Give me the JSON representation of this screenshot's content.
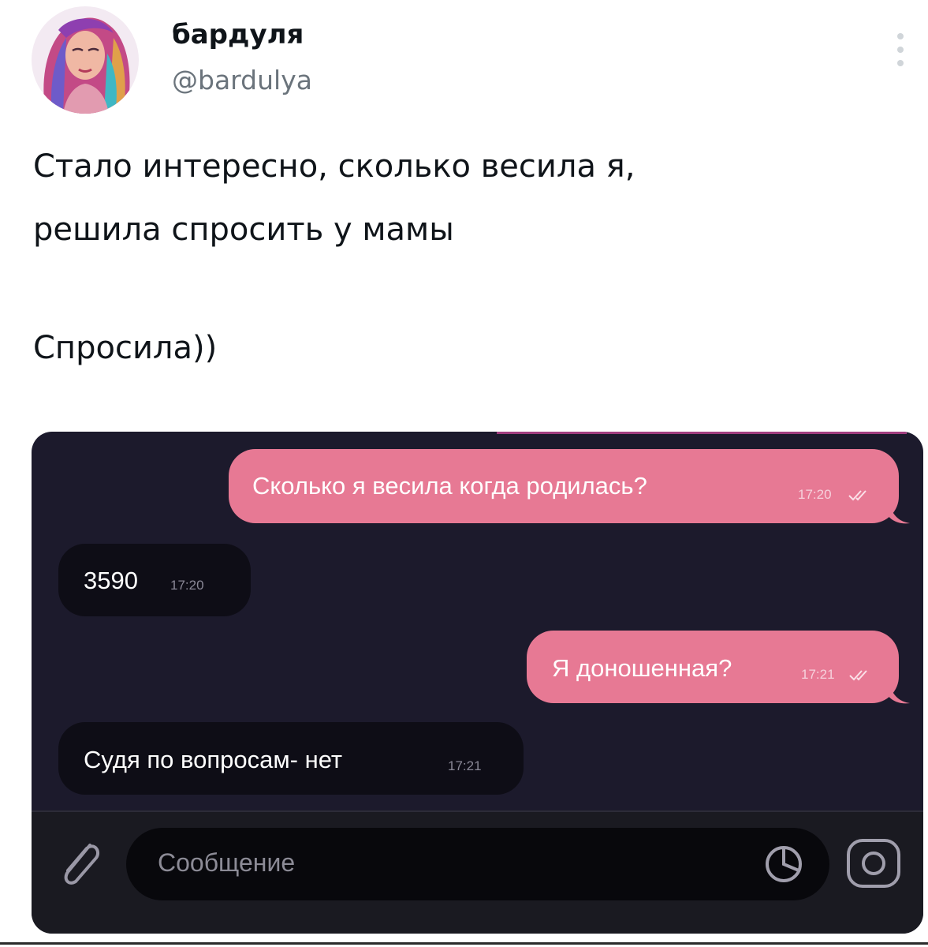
{
  "header": {
    "display_name": "бардуля",
    "username": "@bardulya"
  },
  "tweet": {
    "lines": [
      "Стало интересно, сколько весила я,",
      "решила спросить у мамы",
      "Спросила))"
    ]
  },
  "chat": {
    "messages": [
      {
        "direction": "outgoing",
        "text": "Сколько я весила когда родилась?",
        "time": "17:20"
      },
      {
        "direction": "incoming",
        "text": "3590",
        "time": "17:20"
      },
      {
        "direction": "outgoing",
        "text": "Я доношенная?",
        "time": "17:21"
      },
      {
        "direction": "incoming",
        "text": "Судя по вопросам- нет",
        "time": "17:21"
      }
    ],
    "input_placeholder": "Сообщение",
    "icons": [
      "paperclip-icon",
      "sticker-icon",
      "camera-icon",
      "read-check-icon"
    ],
    "colors": {
      "background": "#1c1a2c",
      "outgoing_bubble": "#e77994",
      "incoming_bubble": "#0e0d16"
    }
  }
}
